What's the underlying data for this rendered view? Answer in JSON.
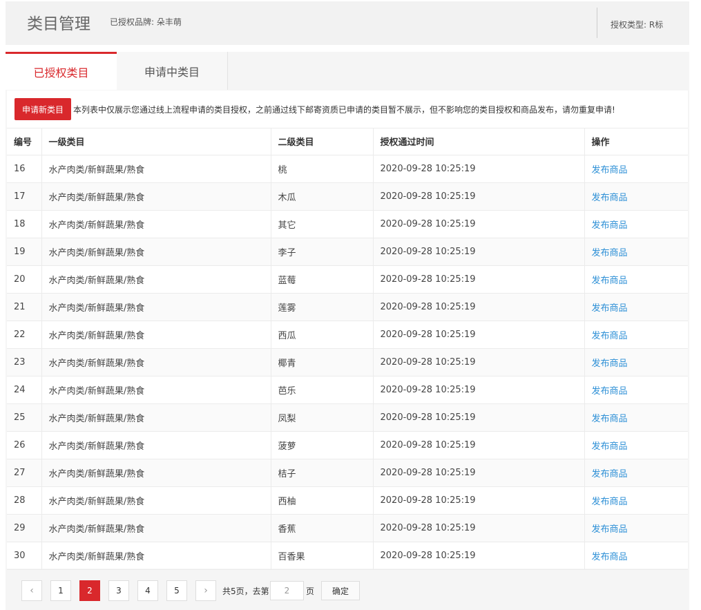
{
  "header": {
    "title": "类目管理",
    "brand_label": "已授权品牌: 朵丰萌",
    "auth_type": "授权类型: R标"
  },
  "tabs": [
    {
      "label": "已授权类目",
      "active": true
    },
    {
      "label": "申请中类目",
      "active": false
    }
  ],
  "notice": {
    "apply_button": "申请新类目",
    "text": "本列表中仅展示您通过线上流程申请的类目授权，之前通过线下邮寄资质已申请的类目暂不展示，但不影响您的类目授权和商品发布，请勿重复申请!"
  },
  "table": {
    "headers": [
      "编号",
      "一级类目",
      "二级类目",
      "授权通过时间",
      "操作"
    ],
    "rows": [
      {
        "id": "16",
        "level1": "水产肉类/新鲜蔬果/熟食",
        "level2": "桃",
        "time": "2020-09-28 10:25:19",
        "action": "发布商品"
      },
      {
        "id": "17",
        "level1": "水产肉类/新鲜蔬果/熟食",
        "level2": "木瓜",
        "time": "2020-09-28 10:25:19",
        "action": "发布商品"
      },
      {
        "id": "18",
        "level1": "水产肉类/新鲜蔬果/熟食",
        "level2": "其它",
        "time": "2020-09-28 10:25:19",
        "action": "发布商品"
      },
      {
        "id": "19",
        "level1": "水产肉类/新鲜蔬果/熟食",
        "level2": "李子",
        "time": "2020-09-28 10:25:19",
        "action": "发布商品"
      },
      {
        "id": "20",
        "level1": "水产肉类/新鲜蔬果/熟食",
        "level2": "蓝莓",
        "time": "2020-09-28 10:25:19",
        "action": "发布商品"
      },
      {
        "id": "21",
        "level1": "水产肉类/新鲜蔬果/熟食",
        "level2": "莲雾",
        "time": "2020-09-28 10:25:19",
        "action": "发布商品"
      },
      {
        "id": "22",
        "level1": "水产肉类/新鲜蔬果/熟食",
        "level2": "西瓜",
        "time": "2020-09-28 10:25:19",
        "action": "发布商品"
      },
      {
        "id": "23",
        "level1": "水产肉类/新鲜蔬果/熟食",
        "level2": "椰青",
        "time": "2020-09-28 10:25:19",
        "action": "发布商品"
      },
      {
        "id": "24",
        "level1": "水产肉类/新鲜蔬果/熟食",
        "level2": "芭乐",
        "time": "2020-09-28 10:25:19",
        "action": "发布商品"
      },
      {
        "id": "25",
        "level1": "水产肉类/新鲜蔬果/熟食",
        "level2": "凤梨",
        "time": "2020-09-28 10:25:19",
        "action": "发布商品"
      },
      {
        "id": "26",
        "level1": "水产肉类/新鲜蔬果/熟食",
        "level2": "菠萝",
        "time": "2020-09-28 10:25:19",
        "action": "发布商品"
      },
      {
        "id": "27",
        "level1": "水产肉类/新鲜蔬果/熟食",
        "level2": "桔子",
        "time": "2020-09-28 10:25:19",
        "action": "发布商品"
      },
      {
        "id": "28",
        "level1": "水产肉类/新鲜蔬果/熟食",
        "level2": "西柚",
        "time": "2020-09-28 10:25:19",
        "action": "发布商品"
      },
      {
        "id": "29",
        "level1": "水产肉类/新鲜蔬果/熟食",
        "level2": "香蕉",
        "time": "2020-09-28 10:25:19",
        "action": "发布商品"
      },
      {
        "id": "30",
        "level1": "水产肉类/新鲜蔬果/熟食",
        "level2": "百香果",
        "time": "2020-09-28 10:25:19",
        "action": "发布商品"
      }
    ]
  },
  "pagination": {
    "prev_icon": "chevron-left-icon",
    "next_icon": "chevron-right-icon",
    "pages": [
      "1",
      "2",
      "3",
      "4",
      "5"
    ],
    "current": "2",
    "total_text": "共5页，去第",
    "input_value": "2",
    "unit": "页",
    "confirm": "确定"
  },
  "colors": {
    "accent": "#d9282c",
    "link": "#2c8fd6",
    "header_bg": "#f2f2f2"
  }
}
